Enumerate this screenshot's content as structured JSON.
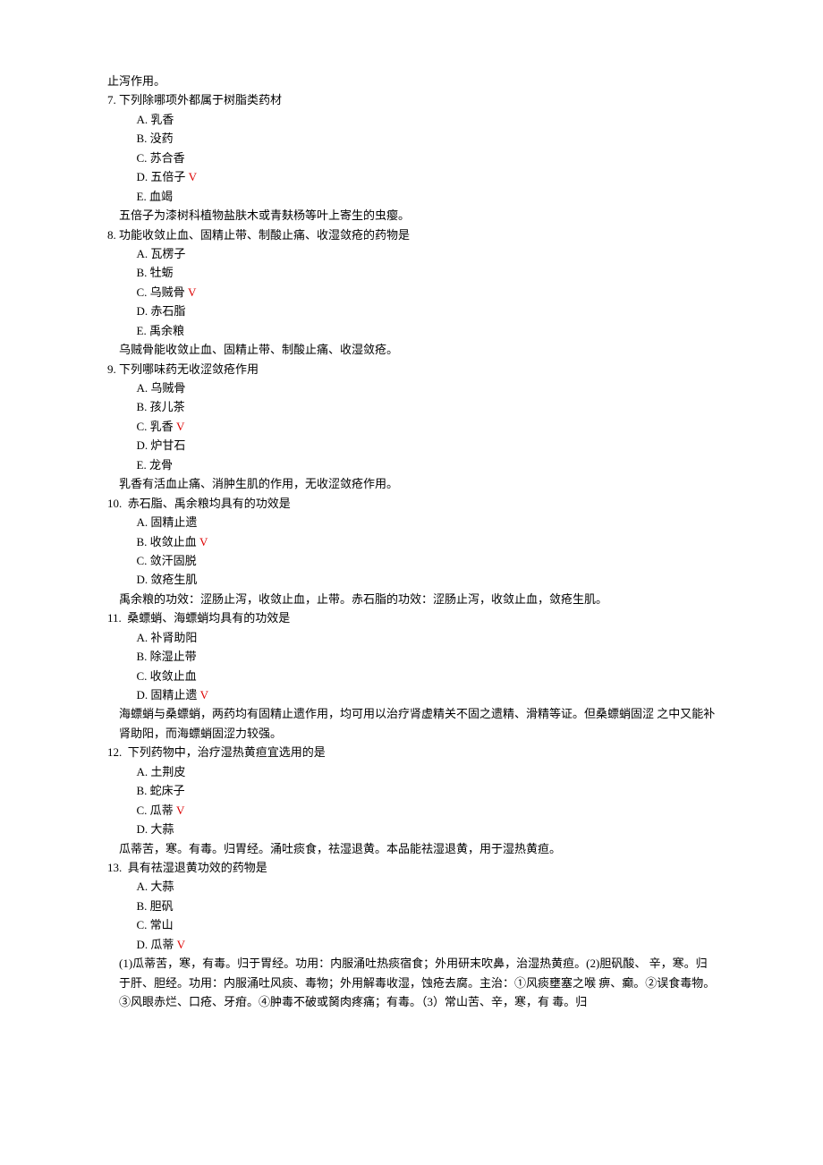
{
  "top_fragment": "止泻作用。",
  "questions": [
    {
      "num": "7.",
      "text": "下列除哪项外都属于树脂类药材",
      "options": [
        {
          "label": "A.",
          "text": "乳香",
          "correct": false
        },
        {
          "label": "B.",
          "text": "没药",
          "correct": false
        },
        {
          "label": "C.",
          "text": "苏合香",
          "correct": false
        },
        {
          "label": "D.",
          "text": "五倍子",
          "correct": true
        },
        {
          "label": "E.",
          "text": "血竭",
          "correct": false
        }
      ],
      "explain": "五倍子为漆树科植物盐肤木或青麸杨等叶上寄生的虫瘿。"
    },
    {
      "num": "8.",
      "text": "功能收敛止血、固精止带、制酸止痛、收湿敛疮的药物是",
      "options": [
        {
          "label": "A.",
          "text": "瓦楞子",
          "correct": false
        },
        {
          "label": "B.",
          "text": "牡蛎",
          "correct": false
        },
        {
          "label": "C.",
          "text": "乌贼骨",
          "correct": true
        },
        {
          "label": "D.",
          "text": "赤石脂",
          "correct": false
        },
        {
          "label": "E.",
          "text": "禹余粮",
          "correct": false
        }
      ],
      "explain": "乌贼骨能收敛止血、固精止带、制酸止痛、收湿敛疮。"
    },
    {
      "num": "9.",
      "text": "下列哪味药无收涩敛疮作用",
      "options": [
        {
          "label": "A.",
          "text": "乌贼骨",
          "correct": false
        },
        {
          "label": "B.",
          "text": "孩儿茶",
          "correct": false
        },
        {
          "label": "C.",
          "text": "乳香",
          "correct": true
        },
        {
          "label": "D.",
          "text": "炉甘石",
          "correct": false
        },
        {
          "label": "E.",
          "text": "龙骨",
          "correct": false
        }
      ],
      "explain": "乳香有活血止痛、消肿生肌的作用，无收涩敛疮作用。"
    },
    {
      "num": "10.",
      "text": " 赤石脂、禹余粮均具有的功效是",
      "options": [
        {
          "label": "A.",
          "text": "固精止遗",
          "correct": false
        },
        {
          "label": "B.",
          "text": "收敛止血",
          "correct": true
        },
        {
          "label": "C.",
          "text": "敛汗固脱",
          "correct": false
        },
        {
          "label": "D.",
          "text": "敛疮生肌",
          "correct": false
        }
      ],
      "explain": "禹余粮的功效：涩肠止泻，收敛止血，止带。赤石脂的功效：涩肠止泻，收敛止血，敛疮生肌。"
    },
    {
      "num": "11.",
      "text": " 桑螵蛸、海螵蛸均具有的功效是",
      "options": [
        {
          "label": "A.",
          "text": "补肾助阳",
          "correct": false
        },
        {
          "label": "B.",
          "text": "除湿止带",
          "correct": false
        },
        {
          "label": "C.",
          "text": "收敛止血",
          "correct": false
        },
        {
          "label": "D.",
          "text": "固精止遗",
          "correct": true
        }
      ],
      "explain": "海螵蛸与桑螵蛸，两药均有固精止遗作用，均可用以治疗肾虚精关不固之遗精、滑精等证。但桑螵蛸固涩 之中又能补肾助阳，而海螵蛸固涩力较强。"
    },
    {
      "num": "12.",
      "text": " 下列药物中，治疗湿热黄疸宜选用的是",
      "options": [
        {
          "label": "A.",
          "text": "土荆皮",
          "correct": false
        },
        {
          "label": "B.",
          "text": "蛇床子",
          "correct": false
        },
        {
          "label": "C.",
          "text": "瓜蒂",
          "correct": true
        },
        {
          "label": "D.",
          "text": "大蒜",
          "correct": false
        }
      ],
      "explain": "瓜蒂苦，寒。有毒。归胃经。涌吐痰食，祛湿退黄。本品能祛湿退黄，用于湿热黄疸。"
    },
    {
      "num": "13.",
      "text": " 具有祛湿退黄功效的药物是",
      "options": [
        {
          "label": "A.",
          "text": "大蒜",
          "correct": false
        },
        {
          "label": "B.",
          "text": "胆矾",
          "correct": false
        },
        {
          "label": "C.",
          "text": "常山",
          "correct": false
        },
        {
          "label": "D.",
          "text": "瓜蒂",
          "correct": true
        }
      ],
      "explain": "(1)瓜蒂苦，寒，有毒。归于胃经。功用：内服涌吐热痰宿食；外用研末吹鼻，治湿热黄疸。(2)胆矾酸、 辛，寒。归于肝、胆经。功用：内服涌吐风痰、毒物；外用解毒收湿，蚀疮去腐。主治：①风痰壅塞之喉 痹、癫。②误食毒物。③风眼赤烂、口疮、牙疳。④肿毒不破或胬肉疼痛；有毒。（3）常山苦、辛，寒，有 毒。归"
    }
  ],
  "mark": "V"
}
